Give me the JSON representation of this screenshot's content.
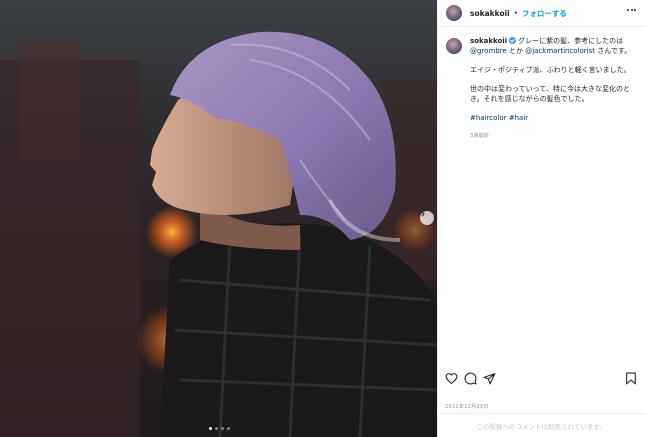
{
  "post": {
    "username": "sokakkoii",
    "follow_label": "フォローする",
    "separator": "•",
    "caption": {
      "line1_text": "グレーに紫の髪、参考にしたのは",
      "mention1": "@grombre",
      "mid_text": " とか ",
      "mention2": "@jackmartincolorist",
      "line1_end": " さんです。",
      "para2": "エイジ・ポジティブ派、ふわりと軽く言いました。",
      "para3": "世の中は変わっていって、特に今は大きな変化のとき。それを感じながらの髪色でした。",
      "hashtag1": "#haircolor",
      "hashtag2": "#hair"
    },
    "time_ago": "3週間前",
    "date": "2021年12月29日",
    "comments_disabled": "この投稿へのコメントは制限されています。",
    "carousel": {
      "total": 4,
      "active": 0
    }
  },
  "icons": {
    "like": "heart-icon",
    "comment": "comment-icon",
    "share": "share-icon",
    "save": "bookmark-icon",
    "more": "more-options-icon",
    "next": "chevron-right-icon"
  },
  "colors": {
    "link": "#00376b",
    "follow": "#0095f6",
    "verified": "#3897f0",
    "muted": "#8e8e8e"
  }
}
